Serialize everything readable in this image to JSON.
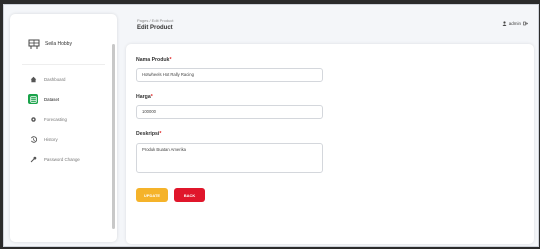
{
  "brand": {
    "name": "Seila Hobby",
    "icon": "logo-icon"
  },
  "sidebar": {
    "items": [
      {
        "label": "Dashboard",
        "icon": "home-icon",
        "active": false
      },
      {
        "label": "Dataset",
        "icon": "database-icon",
        "active": true
      },
      {
        "label": "Forecasting",
        "icon": "gear-icon",
        "active": false
      },
      {
        "label": "History",
        "icon": "history-icon",
        "active": false
      },
      {
        "label": "Password Change",
        "icon": "key-icon",
        "active": false
      }
    ]
  },
  "header": {
    "breadcrumb": "Pages / Edit Product",
    "title": "Edit Product",
    "user": "admin"
  },
  "form": {
    "nama_label": "Nama Produk",
    "nama_value": "Hotwheels Hot Rally Racing",
    "harga_label": "Harga",
    "harga_value": "100000",
    "deskripsi_label": "Deskripsi",
    "deskripsi_value": "Produk Buatan Amerika",
    "required_mark": "*"
  },
  "buttons": {
    "update": "Update",
    "back": "Back"
  },
  "colors": {
    "accent_green": "#1aa34a",
    "update": "#f5b32a",
    "back": "#e0162b"
  }
}
